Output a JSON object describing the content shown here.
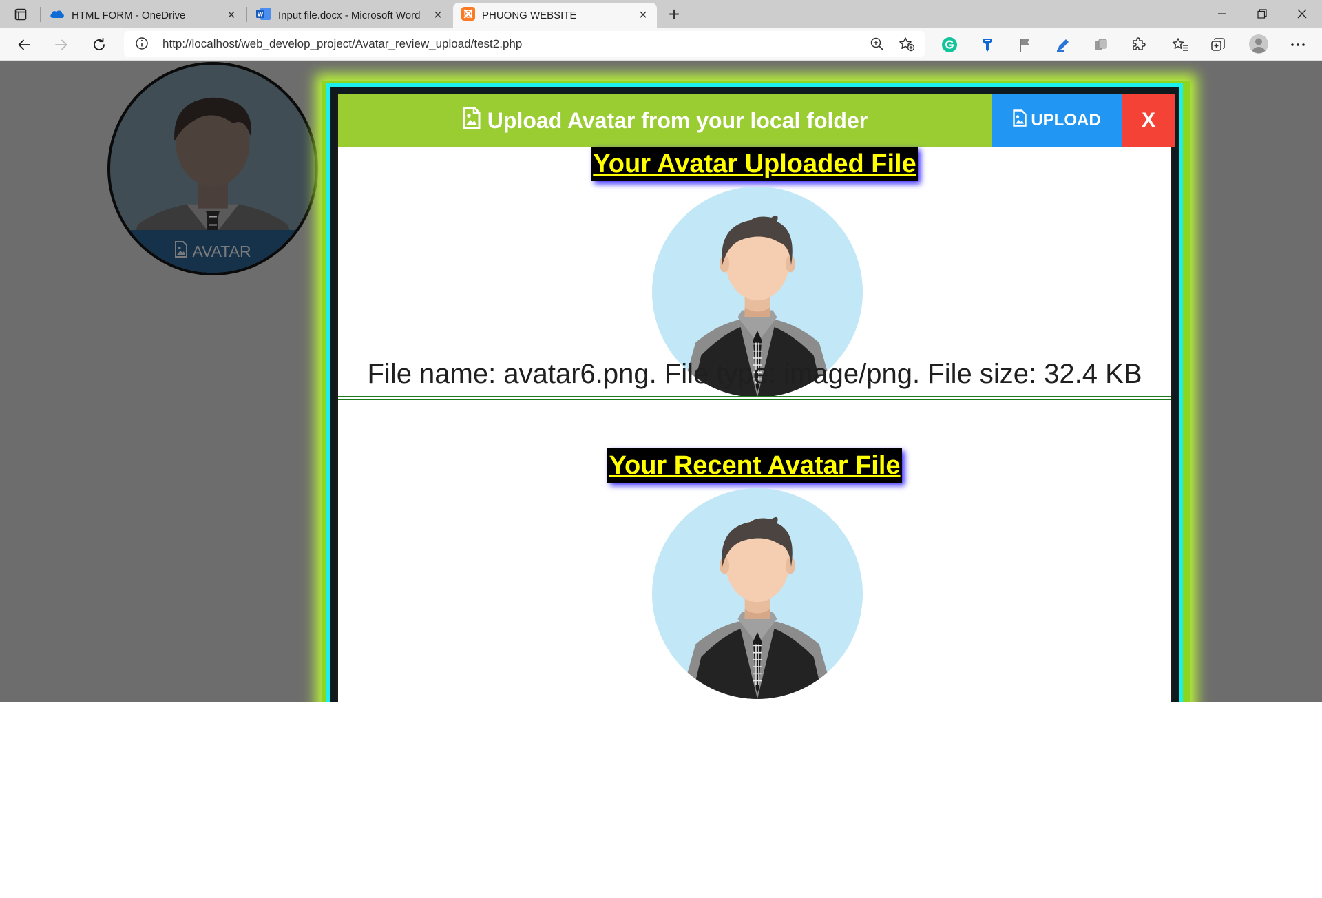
{
  "browser": {
    "tabs": [
      {
        "title": "HTML FORM - OneDrive",
        "icon": "onedrive-icon",
        "active": false
      },
      {
        "title": "Input file.docx - Microsoft Word",
        "icon": "word-icon",
        "active": false
      },
      {
        "title": "PHUONG WEBSITE",
        "icon": "xampp-icon",
        "active": true
      }
    ],
    "address": {
      "url": "http://localhost/web_develop_project/Avatar_review_upload/test2.php"
    }
  },
  "sidebar": {
    "avatar_label": "AVATAR"
  },
  "modal": {
    "title": "Upload Avatar from your local folder",
    "upload_label": "UPLOAD",
    "close_label": "X",
    "uploaded_heading": "Your Avatar Uploaded File",
    "file_info": "File name: avatar6.png. File type: image/png. File size: 32.4 KB",
    "recent_heading": "Your Recent Avatar File"
  },
  "colors": {
    "header_green": "#9acd32",
    "upload_blue": "#2196f3",
    "close_red": "#f44336",
    "border_cyan": "#1cf0ee",
    "heading_yellow": "#ffff00"
  }
}
